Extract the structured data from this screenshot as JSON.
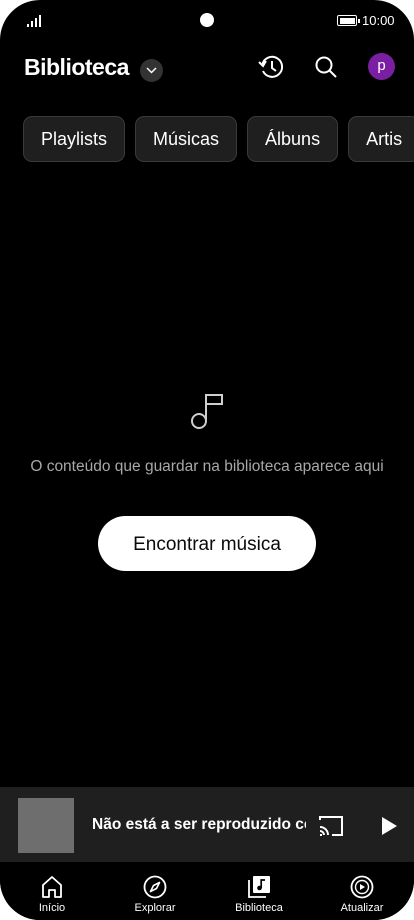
{
  "status_bar": {
    "time": "10:00"
  },
  "header": {
    "title": "Biblioteca",
    "avatar_letter": "p",
    "icons": [
      "history-icon",
      "search-icon"
    ]
  },
  "chips": [
    "Playlists",
    "Músicas",
    "Álbuns",
    "Artis"
  ],
  "empty_state": {
    "icon": "music-note-icon",
    "message": "O conteúdo que guardar na biblioteca aparece aqui",
    "button_label": "Encontrar música"
  },
  "mini_player": {
    "text": "Não está a ser reproduzido co",
    "icons": [
      "cast-icon",
      "play-icon"
    ]
  },
  "bottom_nav": [
    {
      "label": "Início",
      "icon": "home-icon"
    },
    {
      "label": "Explorar",
      "icon": "compass-icon"
    },
    {
      "label": "Biblioteca",
      "icon": "library-icon"
    },
    {
      "label": "Atualizar",
      "icon": "upgrade-icon"
    }
  ],
  "colors": {
    "background": "#000000",
    "chip_background": "#1f1f1f",
    "avatar": "#7b1fa2",
    "player_background": "#1f1f1f",
    "muted_text": "#a8a8a8"
  }
}
